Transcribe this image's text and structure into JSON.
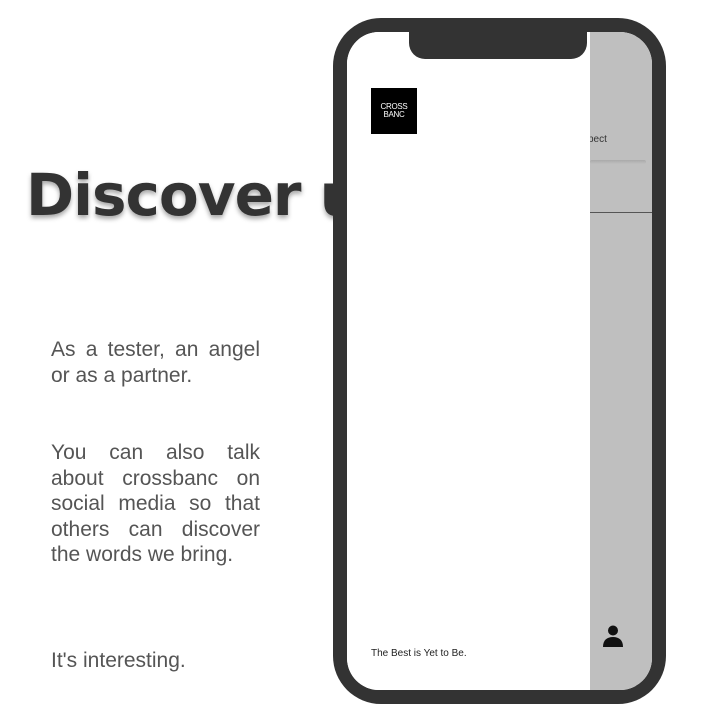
{
  "heading": "Discover us",
  "paragraphs": {
    "p1": "As a tester, an angel or as a partner.",
    "p2": "You can also talk about crossbanc on social media so that others can discover the words we bring.",
    "p3": "It's interesting."
  },
  "phone": {
    "logo": {
      "line1": "CROSS",
      "line2": "BANC"
    },
    "tagline": "The Best is Yet to Be.",
    "overlay_label": "xpect",
    "user_icon": "user-icon"
  },
  "colors": {
    "heading": "#333333",
    "body_text": "#555555",
    "phone_frame": "#333333",
    "overlay": "#bfbfbf",
    "logo_bg": "#000000"
  }
}
